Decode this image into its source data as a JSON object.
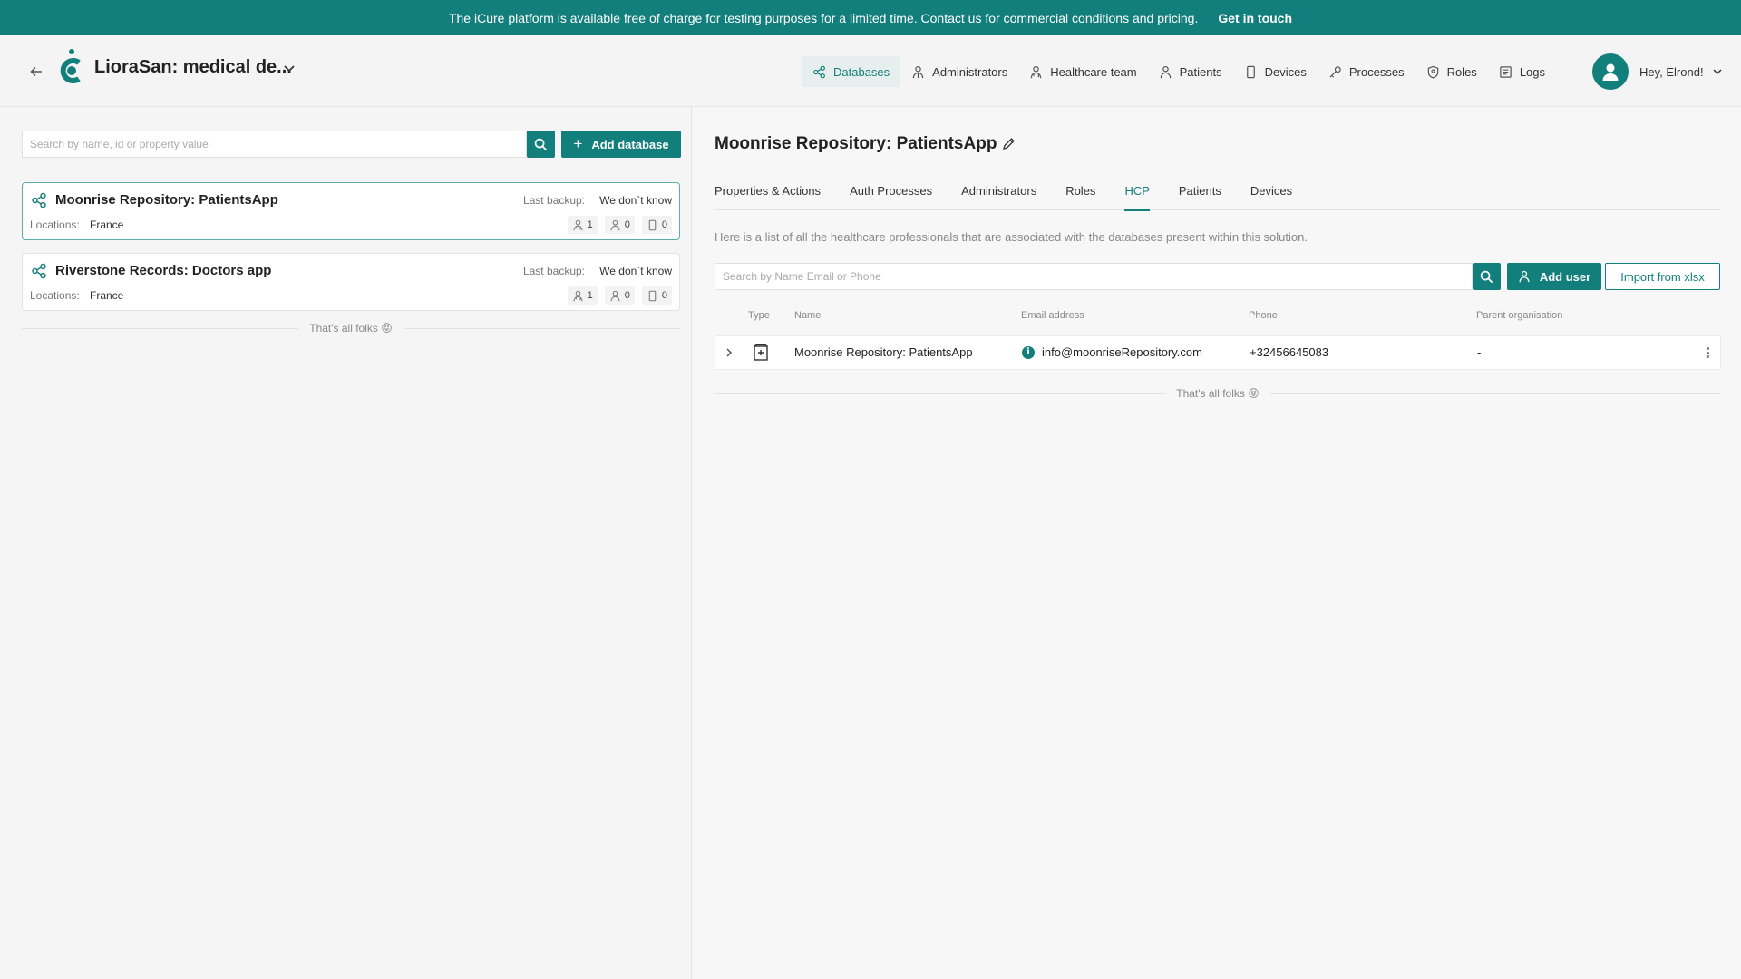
{
  "banner": {
    "message": "The iCure platform is available free of charge for testing purposes for a limited time. Contact us for commercial conditions and pricing.",
    "link_label": "Get in touch"
  },
  "header": {
    "app_title": "LioraSan: medical de...",
    "nav": [
      {
        "label": "Databases",
        "icon": "database-icon",
        "active": true
      },
      {
        "label": "Administrators",
        "icon": "administrator-icon"
      },
      {
        "label": "Healthcare team",
        "icon": "healthcare-team-icon"
      },
      {
        "label": "Patients",
        "icon": "patient-icon"
      },
      {
        "label": "Devices",
        "icon": "device-icon"
      },
      {
        "label": "Processes",
        "icon": "key-icon"
      },
      {
        "label": "Roles",
        "icon": "shield-icon"
      },
      {
        "label": "Logs",
        "icon": "logs-icon"
      }
    ],
    "user_label": "Hey, Elrond!"
  },
  "left": {
    "search_placeholder": "Search by name, id or property value",
    "add_database_label": "Add database",
    "databases": [
      {
        "name": "Moonrise Repository: PatientsApp",
        "backup_label": "Last backup:",
        "backup_value": "We don`t know",
        "locations_label": "Locations:",
        "locations_value": "France",
        "counts": [
          "1",
          "0",
          "0"
        ],
        "selected": true
      },
      {
        "name": "Riverstone Records: Doctors app",
        "backup_label": "Last backup:",
        "backup_value": "We don`t know",
        "locations_label": "Locations:",
        "locations_value": "France",
        "counts": [
          "1",
          "0",
          "0"
        ],
        "selected": false
      }
    ],
    "end_text": "That's all folks 😝"
  },
  "right": {
    "title": "Moonrise Repository: PatientsApp",
    "tabs": [
      "Properties & Actions",
      "Auth Processes",
      "Administrators",
      "Roles",
      "HCP",
      "Patients",
      "Devices"
    ],
    "active_tab": "HCP",
    "description": "Here is a list of all the healthcare professionals that are associated with the databases present within this solution.",
    "search_placeholder": "Search by Name Email or Phone",
    "add_user_label": "Add user",
    "import_label": "Import from xlsx",
    "columns": [
      "Type",
      "Name",
      "Email address",
      "Phone",
      "Parent organisation"
    ],
    "rows": [
      {
        "type_icon": "organisation-icon",
        "name": "Moonrise Repository: PatientsApp",
        "email": "info@moonriseRepository.com",
        "phone": "+32456645083",
        "parent": "-"
      }
    ],
    "end_text": "That's all folks 😝"
  },
  "colors": {
    "accent": "#137f7c",
    "selected_border": "#5aaeab"
  }
}
